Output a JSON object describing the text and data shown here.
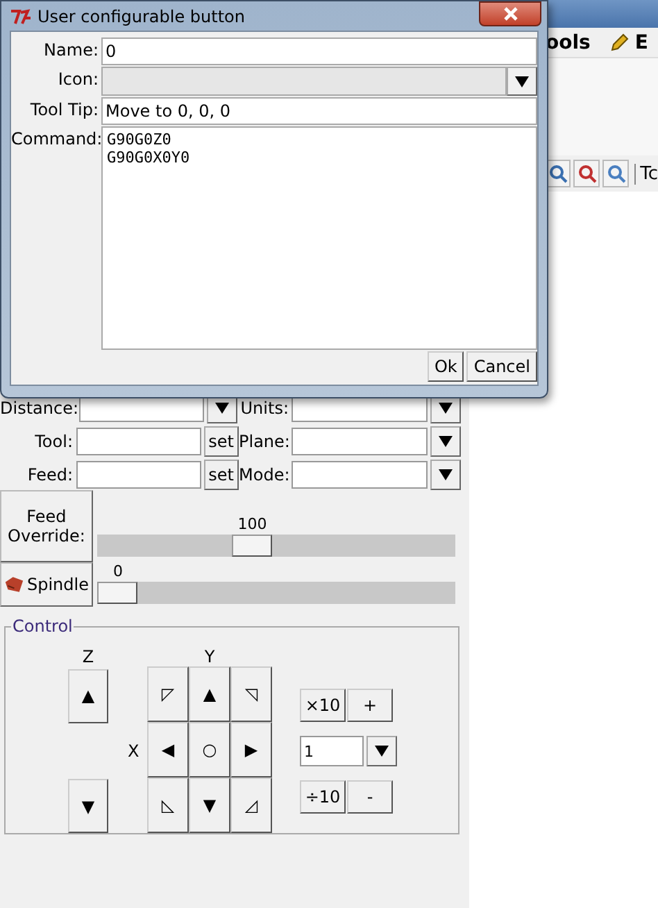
{
  "app": {
    "menu_items": [
      {
        "label": "ools",
        "icon": false
      },
      {
        "label": "E",
        "icon": true
      }
    ],
    "toolbar_text": "Tc"
  },
  "dialog": {
    "title": "User configurable button",
    "fields": [
      {
        "label": "Name:",
        "kind": "text",
        "value": "0"
      },
      {
        "label": "Icon:",
        "kind": "combo"
      },
      {
        "label": "Tool Tip:",
        "kind": "text",
        "value": "Move to 0, 0, 0"
      },
      {
        "label": "Command:",
        "kind": "multiline",
        "lines": [
          "G90G0Z0",
          "G90G0X0Y0"
        ]
      }
    ],
    "buttons": [
      "Ok",
      "Cancel"
    ]
  },
  "settings": {
    "left": [
      {
        "label": "Distance:",
        "kind": "dropdown"
      },
      {
        "label": "Tool:",
        "kind": "set",
        "button": "set"
      },
      {
        "label": "Feed:",
        "kind": "set",
        "button": "set"
      }
    ],
    "right": [
      {
        "label": "Units:",
        "kind": "dropdown"
      },
      {
        "label": "Plane:",
        "kind": "dropdown"
      },
      {
        "label": "Mode:",
        "kind": "dropdown"
      }
    ]
  },
  "sliders": [
    {
      "label": "Feed Override:",
      "icon": false,
      "reading": "100",
      "level": 0.43
    },
    {
      "label": "Spindle",
      "icon": true,
      "reading": "0",
      "level": 0
    }
  ],
  "control": {
    "title": "Control",
    "z_label": "Z",
    "y_label": "Y",
    "x_label": "X",
    "z_buttons": [
      "▲",
      "▼"
    ],
    "xy_buttons": [
      "◸",
      "▲",
      "◹",
      "◀",
      "○",
      "▶",
      "◺",
      "▼",
      "◿"
    ],
    "step": {
      "multiply": "×10",
      "plus": "+",
      "value": "1",
      "divide": "÷10",
      "minus": "-"
    }
  }
}
